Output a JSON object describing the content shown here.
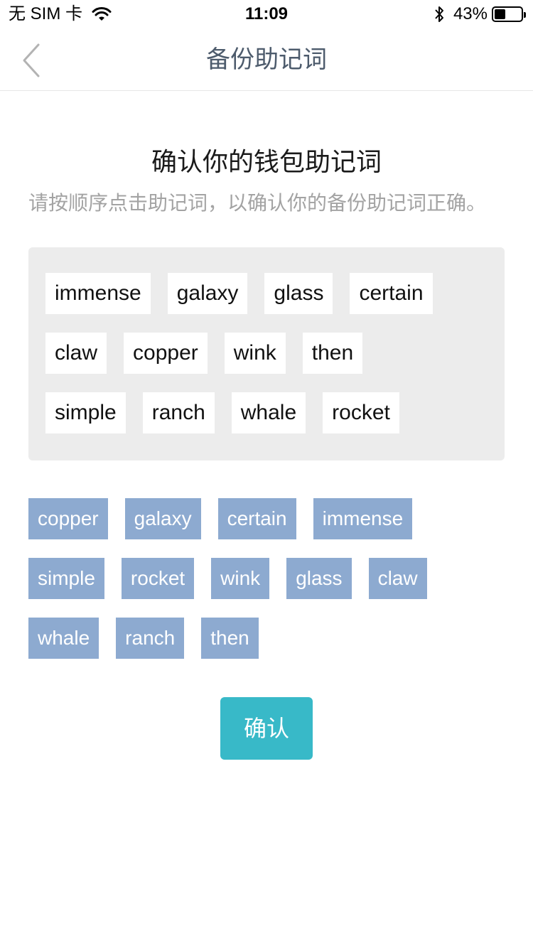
{
  "status_bar": {
    "carrier": "无 SIM 卡",
    "time": "11:09",
    "battery_percent": "43%",
    "battery_level": 0.43
  },
  "nav": {
    "title": "备份助记词",
    "back_icon": "chevron-left-icon"
  },
  "heading": "确认你的钱包助记词",
  "subheading": "请按顺序点击助记词，以确认你的备份助记词正确。",
  "selected_words": [
    [
      "immense",
      "galaxy",
      "glass",
      "certain"
    ],
    [
      "claw",
      "copper",
      "wink",
      "then"
    ],
    [
      "simple",
      "ranch",
      "whale",
      "rocket"
    ]
  ],
  "candidate_words": [
    [
      "copper",
      "galaxy",
      "certain",
      "immense"
    ],
    [
      "simple",
      "rocket",
      "wink",
      "glass",
      "claw"
    ],
    [
      "whale",
      "ranch",
      "then"
    ]
  ],
  "confirm_label": "确认",
  "colors": {
    "accent": "#38b9c8",
    "candidate_bg": "#8daad0",
    "panel_bg": "#ececec",
    "nav_title": "#4d5b6c"
  }
}
